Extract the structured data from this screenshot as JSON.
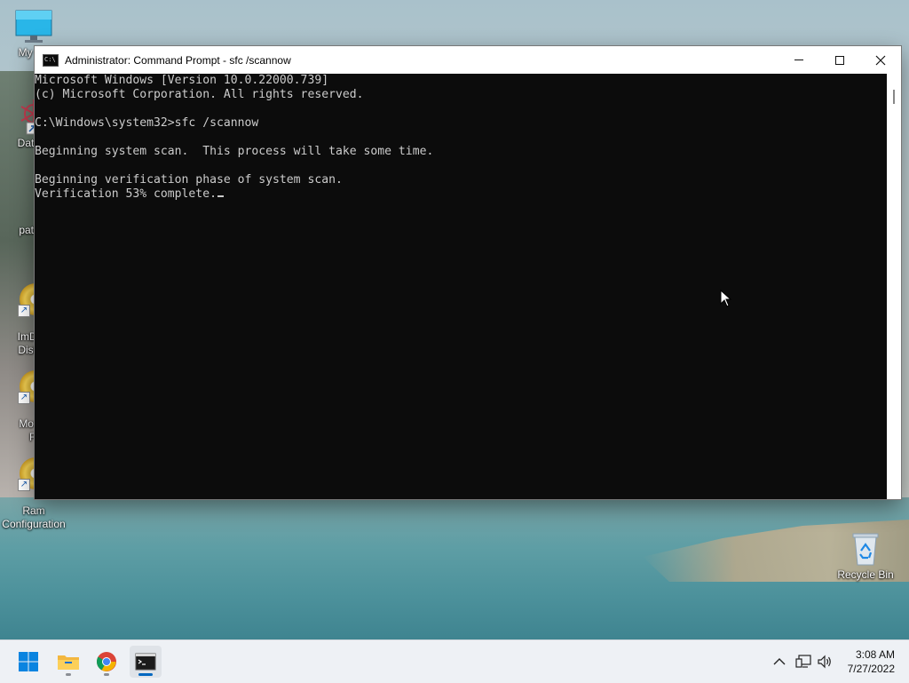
{
  "desktop": {
    "icons": [
      {
        "label": "My Co",
        "icon": "monitor-icon"
      },
      {
        "label": "DataW",
        "icon": "datawarp-icon"
      },
      {
        "label": "pathm",
        "icon": "file-icon"
      },
      {
        "label": "ImDisk\nDisk D",
        "icon": "disc-icon"
      },
      {
        "label": "Mount\nFi",
        "icon": "disc-icon"
      },
      {
        "label": "Ram\nConfiguration",
        "icon": "disc-icon"
      }
    ],
    "recycle_bin": {
      "label": "Recycle Bin",
      "icon": "recycle-bin-icon"
    }
  },
  "window": {
    "title": "Administrator: Command Prompt - sfc  /scannow",
    "controls": {
      "minimize": "minimize-icon",
      "maximize": "maximize-icon",
      "close": "close-icon"
    }
  },
  "console": {
    "lines": [
      "Microsoft Windows [Version 10.0.22000.739]",
      "(c) Microsoft Corporation. All rights reserved.",
      "",
      "C:\\Windows\\system32>sfc /scannow",
      "",
      "Beginning system scan.  This process will take some time.",
      "",
      "Beginning verification phase of system scan.",
      "Verification 53% complete."
    ]
  },
  "taskbar": {
    "items": [
      {
        "name": "start",
        "icon": "windows-logo-icon"
      },
      {
        "name": "file-explorer",
        "icon": "folder-icon"
      },
      {
        "name": "chrome",
        "icon": "chrome-icon"
      },
      {
        "name": "command-prompt",
        "icon": "terminal-icon"
      }
    ],
    "tray": {
      "icons": [
        "chevron-up-icon",
        "network-icon",
        "volume-icon"
      ],
      "time": "3:08 AM",
      "date": "7/27/2022"
    }
  },
  "colors": {
    "console_bg": "#0c0c0c",
    "console_text": "#cccccc",
    "accent": "#0067c0"
  }
}
